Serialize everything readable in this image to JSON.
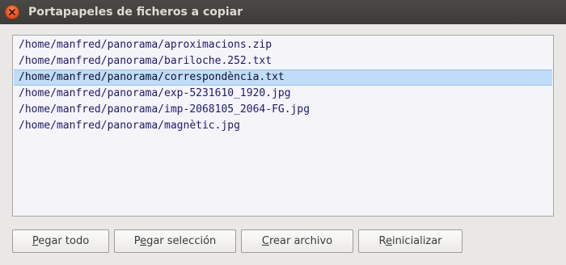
{
  "window": {
    "title": "Portapapeles de ficheros a copiar"
  },
  "files": {
    "items": [
      "/home/manfred/panorama/aproximacions.zip",
      "/home/manfred/panorama/bariloche.252.txt",
      "/home/manfred/panorama/correspondència.txt",
      "/home/manfred/panorama/exp-5231610_1920.jpg",
      "/home/manfred/panorama/imp-2068105_2064-FG.jpg",
      "/home/manfred/panorama/magnètic.jpg"
    ],
    "selected_index": 2
  },
  "buttons": {
    "paste_all": {
      "mnemonic": "P",
      "rest": "egar todo"
    },
    "paste_selection": {
      "pre": "P",
      "mnemonic": "e",
      "rest": "gar selección"
    },
    "create_file": {
      "mnemonic": "C",
      "rest": "rear archivo"
    },
    "reset": {
      "pre": "R",
      "mnemonic": "e",
      "rest": "inicializar"
    }
  },
  "icons": {
    "close": "close-icon"
  },
  "colors": {
    "titlebar": "#3c3b37",
    "close_button": "#e5561f",
    "selection": "#bfdcf8",
    "list_text": "#1c1c6a"
  }
}
